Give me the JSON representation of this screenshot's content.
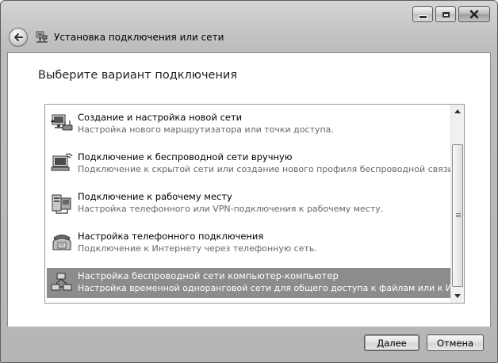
{
  "window": {
    "title": "Установка подключения или сети",
    "controls": {
      "minimize": "minimize-icon",
      "maximize": "maximize-icon",
      "close": "close-icon"
    }
  },
  "page": {
    "heading": "Выберите вариант подключения"
  },
  "options": [
    {
      "title": "Создание и настройка новой сети",
      "description": "Настройка нового маршрутизатора или точки доступа.",
      "icon": "router-network-icon"
    },
    {
      "title": "Подключение к беспроводной сети вручную",
      "description": "Подключение к скрытой сети или создание нового профиля беспроводной связи.",
      "icon": "wireless-network-icon"
    },
    {
      "title": "Подключение к рабочему месту",
      "description": "Настройка телефонного или VPN-подключения к рабочему месту.",
      "icon": "workplace-network-icon"
    },
    {
      "title": "Настройка телефонного подключения",
      "description": "Подключение к Интернету через телефонную сеть.",
      "icon": "telephone-icon"
    },
    {
      "title": "Настройка беспроводной сети компьютер-компьютер",
      "description": "Настройка временной одноранговой сети для общего доступа к файлам или к Инт...",
      "icon": "adhoc-network-icon",
      "selected": true
    }
  ],
  "buttons": {
    "next": "Далее",
    "cancel": "Отмена"
  },
  "colors": {
    "selection": "#8c8c8c",
    "window_frame": "#bdbdbd"
  }
}
